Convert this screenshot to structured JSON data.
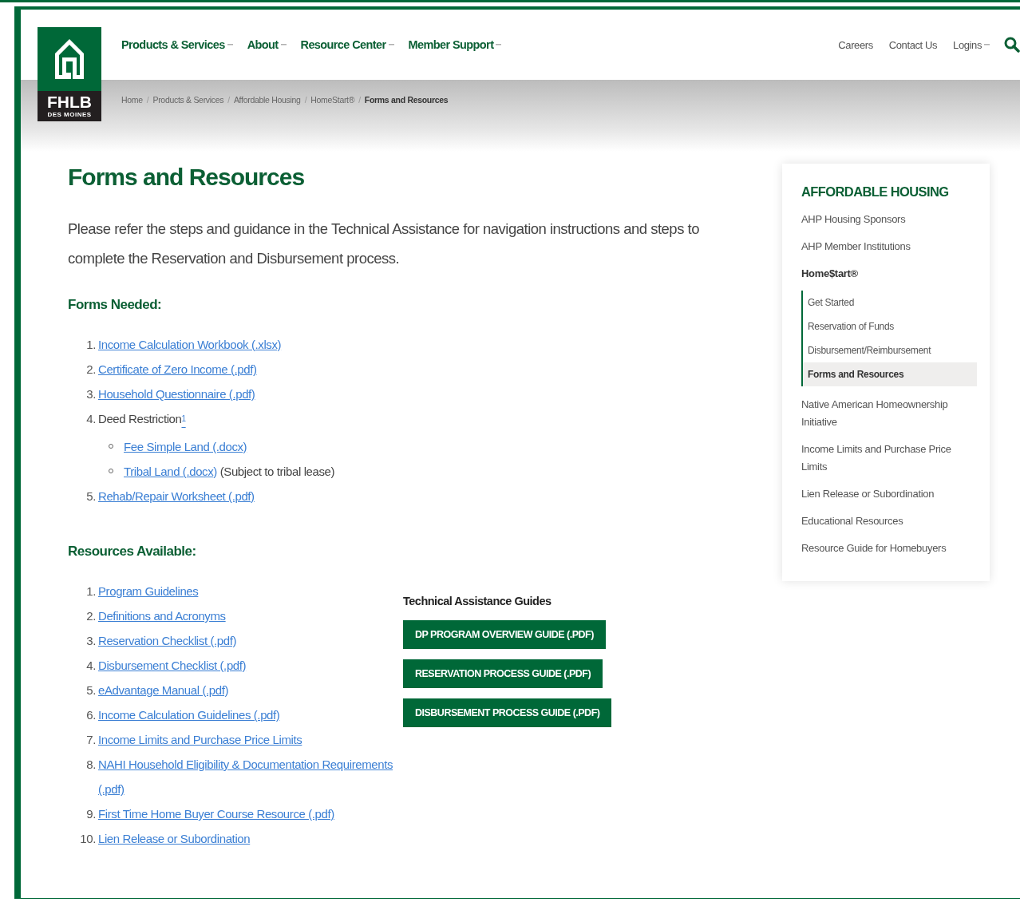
{
  "logo": {
    "name": "FHLB",
    "subtitle": "DES MOINES"
  },
  "main_nav": [
    {
      "label": "Products & Services",
      "dropdown": true
    },
    {
      "label": "About",
      "dropdown": true
    },
    {
      "label": "Resource Center",
      "dropdown": true
    },
    {
      "label": "Member Support",
      "dropdown": true
    }
  ],
  "utility_nav": [
    {
      "label": "Careers",
      "dropdown": false
    },
    {
      "label": "Contact Us",
      "dropdown": false
    },
    {
      "label": "Logins",
      "dropdown": true
    }
  ],
  "breadcrumb_separator": "/",
  "breadcrumb": [
    {
      "label": "Home",
      "current": false
    },
    {
      "label": "Products & Services",
      "current": false
    },
    {
      "label": "Affordable Housing",
      "current": false
    },
    {
      "label": "HomeStart®",
      "current": false
    },
    {
      "label": "Forms and Resources",
      "current": true
    }
  ],
  "title": "Forms and Resources",
  "intro": "Please refer the steps and guidance in the Technical Assistance for navigation instructions and steps to complete the Reservation and Disbursement process.",
  "forms_heading": "Forms Needed:",
  "forms": [
    {
      "number": "1.",
      "text": "Income Calculation Workbook (.xlsx)",
      "kind": "link"
    },
    {
      "number": "2.",
      "text": "Certificate of Zero Income (.pdf)",
      "kind": "link"
    },
    {
      "number": "3.",
      "text": "Household Questionnaire (.pdf)",
      "kind": "link"
    },
    {
      "number": "4.",
      "text": "Deed Restriction",
      "kind": "text",
      "footnote": "1",
      "children": [
        {
          "text": "Fee Simple Land (.docx)"
        },
        {
          "text": "Tribal Land (.docx)",
          "note": "(Subject to tribal lease)"
        }
      ]
    },
    {
      "number": "5.",
      "text": "Rehab/Repair Worksheet (.pdf)",
      "kind": "link"
    }
  ],
  "resources_heading": "Resources Available:",
  "resources": [
    {
      "number": "1.",
      "text": "Program Guidelines"
    },
    {
      "number": "2.",
      "text": "Definitions and Acronyms"
    },
    {
      "number": "3.",
      "text": "Reservation Checklist (.pdf)"
    },
    {
      "number": "4.",
      "text": "Disbursement Checklist (.pdf)"
    },
    {
      "number": "5.",
      "text": "eAdvantage Manual (.pdf)"
    },
    {
      "number": "6.",
      "text": "Income Calculation Guidelines (.pdf)"
    },
    {
      "number": "7.",
      "text": "Income Limits and Purchase Price Limits"
    },
    {
      "number": "8.",
      "text": "NAHI Household Eligibility & Documentation Requirements (.pdf)"
    },
    {
      "number": "9.",
      "text": "First Time Home Buyer Course Resource (.pdf)"
    },
    {
      "number": "10.",
      "text": "Lien Release or Subordination"
    }
  ],
  "guides": {
    "heading": "Technical Assistance Guides",
    "buttons": [
      "DP PROGRAM OVERVIEW GUIDE (.PDF)",
      "RESERVATION PROCESS GUIDE (.PDF)",
      "DISBURSEMENT PROCESS GUIDE (.PDF)"
    ]
  },
  "sidebar": {
    "heading": "AFFORDABLE HOUSING",
    "items": [
      {
        "label": "AHP Housing Sponsors",
        "expanded": false
      },
      {
        "label": "AHP Member Institutions",
        "expanded": false
      },
      {
        "label": "Home$tart®",
        "expanded": true,
        "children": [
          {
            "label": "Get Started",
            "selected": false
          },
          {
            "label": "Reservation of Funds",
            "selected": false
          },
          {
            "label": "Disbursement/Reimbursement",
            "selected": false
          },
          {
            "label": "Forms and Resources",
            "selected": true
          }
        ]
      },
      {
        "label": "Native American Homeownership Initiative",
        "expanded": false
      },
      {
        "label": "Income Limits and Purchase Price Limits",
        "expanded": false
      },
      {
        "label": "Lien Release or Subordination",
        "expanded": false
      },
      {
        "label": "Educational Resources",
        "expanded": false
      },
      {
        "label": "Resource Guide for Homebuyers",
        "expanded": false
      }
    ]
  }
}
